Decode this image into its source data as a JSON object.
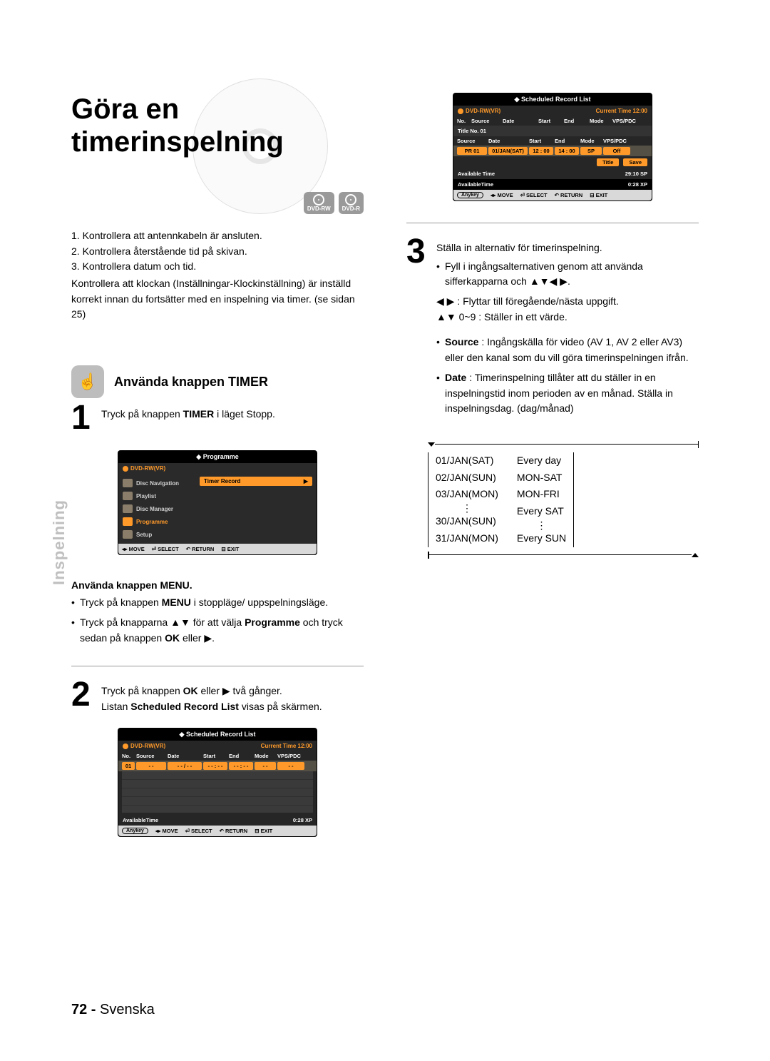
{
  "title": "Göra en\ntimerinspelning",
  "badges": [
    "DVD-RW",
    "DVD-R"
  ],
  "intro": [
    "1. Kontrollera att antennkabeln är ansluten.",
    "2. Kontrollera återstående tid på skivan.",
    "3. Kontrollera datum och tid."
  ],
  "intro_note": "Kontrollera att klockan (Inställningar-Klockinställning) är inställd korrekt innan du fortsätter med en inspelning via timer. (se sidan 25)",
  "section_heading": "Använda knappen TIMER",
  "step1_num": "1",
  "step1_text_a": "Tryck på knappen ",
  "step1_bold": "TIMER",
  "step1_text_b": " i läget Stopp.",
  "osd_prog": {
    "title": "Programme",
    "disc": "DVD-RW(VR)",
    "items": [
      "Disc Navigation",
      "Playlist",
      "Disc Manager",
      "Programme",
      "Setup"
    ],
    "active_index": 3,
    "sub_item": "Timer Record",
    "footer": {
      "move": "MOVE",
      "select": "SELECT",
      "return": "RETURN",
      "exit": "EXIT"
    }
  },
  "menu_heading": "Använda knappen MENU.",
  "menu_b1_a": "Tryck på knappen ",
  "menu_b1_bold": "MENU",
  "menu_b1_b": " i stoppläge/ uppspelningsläge.",
  "menu_b2_a": "Tryck på knapparna ▲▼ för att välja ",
  "menu_b2_bold": "Programme",
  "menu_b2_b": " och tryck sedan på knappen ",
  "menu_b2_bold2": "OK",
  "menu_b2_c": " eller ▶.",
  "step2_num": "2",
  "step2_line1_a": "Tryck på knappen ",
  "step2_line1_bold": "OK",
  "step2_line1_b": " eller ▶ två gånger.",
  "step2_line2_a": "Listan ",
  "step2_line2_bold": "Scheduled Record List",
  "step2_line2_b": " visas på skärmen.",
  "osd_srl_empty": {
    "title": "Scheduled Record List",
    "disc": "DVD-RW(VR)",
    "current_time": "Current Time 12:00",
    "headers": [
      "No.",
      "Source",
      "Date",
      "Start",
      "End",
      "Mode",
      "VPS/PDC"
    ],
    "row01": [
      "01",
      "- -",
      "- - / - -",
      "- - : - -",
      "- - : - -",
      "- -",
      "- -"
    ],
    "avail_label": "AvailableTime",
    "avail_value": "0:28 XP",
    "footer": {
      "anykey": "Anykey",
      "move": "MOVE",
      "select": "SELECT",
      "return": "RETURN",
      "exit": "EXIT"
    }
  },
  "osd_srl_filled": {
    "title": "Scheduled Record List",
    "disc": "DVD-RW(VR)",
    "current_time": "Current Time 12:00",
    "headers": [
      "No.",
      "Source",
      "Date",
      "Start",
      "End",
      "Mode",
      "VPS/PDC"
    ],
    "title_no": "Title No. 01",
    "sub_headers": [
      "Source",
      "Date",
      "Start",
      "End",
      "Mode",
      "VPS/PDC"
    ],
    "row": {
      "source": "PR 01",
      "date": "01/JAN(SAT)",
      "start": "12 : 00",
      "end": "14 : 00",
      "mode": "SP",
      "vps": "Off"
    },
    "btns": [
      "Title",
      "Save"
    ],
    "avail1_label": "Available Time",
    "avail1_value": "29:10 SP",
    "avail2_label": "AvailableTime",
    "avail2_value": "0:28 XP",
    "footer": {
      "anykey": "Anykey",
      "move": "MOVE",
      "select": "SELECT",
      "return": "RETURN",
      "exit": "EXIT"
    }
  },
  "step3_num": "3",
  "step3_intro": "Ställa in alternativ för timerinspelning.",
  "step3_b1": "Fyll i ingångsalternativen genom att använda sifferkapparna och ▲▼◀ ▶.",
  "step3_l1": "◀ ▶ : Flyttar till föregående/nästa uppgift.",
  "step3_l2": "▲▼ 0~9 : Ställer in ett värde.",
  "step3_source_label": "Source",
  "step3_source_text": " : Ingångskälla för video (AV 1, AV 2 eller AV3) eller den kanal som du vill göra timerinspelningen ifrån.",
  "step3_date_label": "Date",
  "step3_date_text": " : Timerinspelning tillåter att du ställer in en inspelningstid inom perioden av en månad. Ställa in inspelningsdag. (dag/månad)",
  "date_cycle": {
    "left": [
      "01/JAN(SAT)",
      "02/JAN(SUN)",
      "03/JAN(MON)",
      "⋮",
      "30/JAN(SUN)",
      "31/JAN(MON)"
    ],
    "right": [
      "Every day",
      "MON-SAT",
      "MON-FRI",
      "Every SAT",
      "⋮",
      "Every SUN"
    ]
  },
  "side_label": "Inspelning",
  "page_footer_num": "72 -",
  "page_footer_lang": "Svenska"
}
